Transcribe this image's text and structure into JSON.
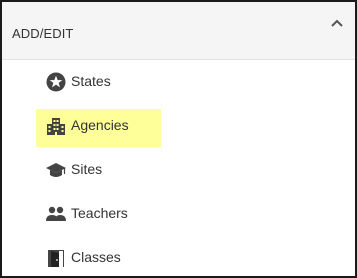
{
  "panel": {
    "header_title": "ADD/EDIT",
    "collapse_icon": "chevron-up-icon"
  },
  "menu": {
    "items": [
      {
        "label": "States",
        "icon": "star-circle-icon",
        "highlighted": false
      },
      {
        "label": "Agencies",
        "icon": "building-icon",
        "highlighted": true
      },
      {
        "label": "Sites",
        "icon": "graduation-cap-icon",
        "highlighted": false
      },
      {
        "label": "Teachers",
        "icon": "people-icon",
        "highlighted": false
      },
      {
        "label": "Classes",
        "icon": "door-icon",
        "highlighted": false
      }
    ]
  },
  "colors": {
    "highlight": "#ffff99",
    "icon": "#444444",
    "header_bg": "#f5f5f5",
    "border": "#1a1a1a"
  }
}
